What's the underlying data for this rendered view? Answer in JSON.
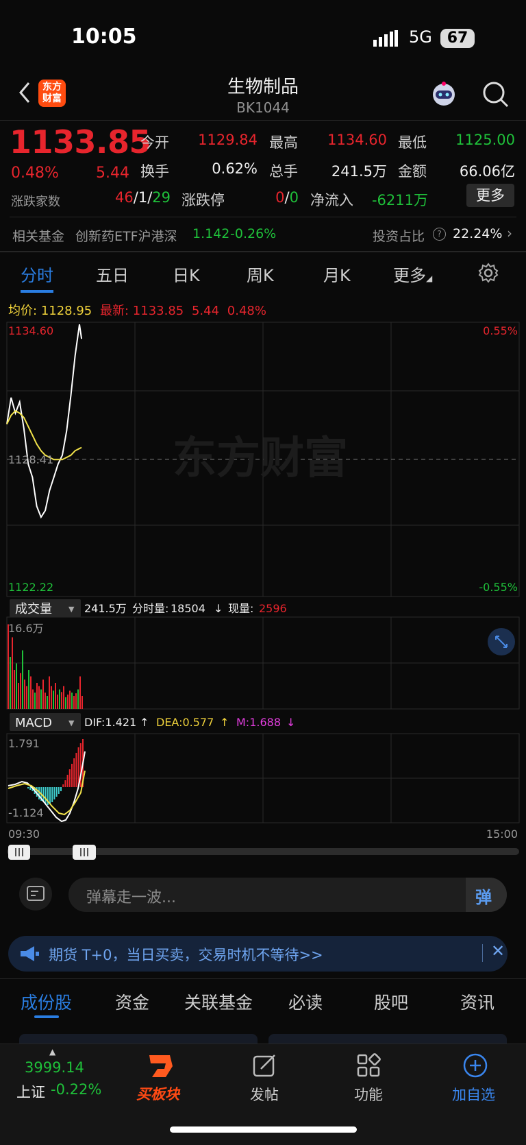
{
  "status": {
    "time": "10:05",
    "network": "5G",
    "battery": "67"
  },
  "header": {
    "title": "生物制品",
    "code": "BK1044",
    "logo_text": "东方\n财富"
  },
  "quote": {
    "price": "1133.85",
    "pct": "0.48%",
    "change": "5.44",
    "fields": [
      {
        "label": "今开",
        "value": "1129.84",
        "color": "red"
      },
      {
        "label": "最高",
        "value": "1134.60",
        "color": "red"
      },
      {
        "label": "最低",
        "value": "1125.00",
        "color": "green"
      },
      {
        "label": "换手",
        "value": "0.62%",
        "color": "white"
      },
      {
        "label": "总手",
        "value": "241.5万",
        "color": "white"
      },
      {
        "label": "金额",
        "value": "66.06亿",
        "color": "white"
      }
    ],
    "adv_label": "涨跌家数",
    "adv_up": "46",
    "adv_flat": "1",
    "adv_down": "29",
    "limit_label": "涨跌停",
    "limit_up": "0",
    "limit_down": "0",
    "netflow_label": "净流入",
    "netflow_value": "-6211万",
    "more_label": "更多"
  },
  "fund": {
    "label": "相关基金",
    "name": "创新药ETF沪港深",
    "price": "1.142",
    "chg": "-0.26%",
    "ratio_label": "投资占比",
    "ratio_value": "22.24%"
  },
  "tabs": [
    "分时",
    "五日",
    "日K",
    "周K",
    "月K",
    "更多"
  ],
  "chart": {
    "avg_label": "均价:",
    "avg_value": "1128.95",
    "last_label": "最新:",
    "last_value": "1133.85",
    "last_chg": "5.44",
    "last_pct": "0.48%",
    "y_top": "1134.60",
    "y_mid": "1128.41",
    "y_bottom": "1122.22",
    "pct_top": "0.55%",
    "pct_bottom": "-0.55%",
    "watermark": "东方财富",
    "vol_selector": "成交量",
    "vol_total": "241.5万",
    "vol_tick_label": "分时量:",
    "vol_tick": "18504",
    "vol_now_label": "现量:",
    "vol_now": "2596",
    "vol_max": "16.6万",
    "macd_selector": "MACD",
    "dif": "DIF:1.421",
    "dea": "DEA:0.577",
    "m": "M:1.688",
    "macd_top": "1.791",
    "macd_bottom": "-1.124",
    "time_start": "09:30",
    "time_end": "15:00"
  },
  "chart_data": {
    "type": "line",
    "title": "",
    "xlabel": "",
    "ylabel": "",
    "ylim": [
      1122.22,
      1134.6
    ],
    "x": [
      "09:30",
      "09:32",
      "09:34",
      "09:36",
      "09:38",
      "09:40",
      "09:42",
      "09:44",
      "09:46",
      "09:48",
      "09:50",
      "09:52",
      "09:54",
      "09:56",
      "09:58",
      "10:00",
      "10:02",
      "10:04",
      "10:05"
    ],
    "series": [
      {
        "name": "最新",
        "values": [
          1130.0,
          1131.2,
          1130.5,
          1131.0,
          1129.8,
          1128.2,
          1127.6,
          1126.3,
          1125.8,
          1126.1,
          1127.0,
          1127.6,
          1128.2,
          1128.6,
          1129.7,
          1131.3,
          1133.1,
          1134.5,
          1133.85
        ]
      },
      {
        "name": "均价",
        "values": [
          1130.0,
          1130.4,
          1130.6,
          1130.5,
          1130.3,
          1129.9,
          1129.5,
          1129.1,
          1128.8,
          1128.6,
          1128.5,
          1128.4,
          1128.4,
          1128.4,
          1128.5,
          1128.6,
          1128.8,
          1128.9,
          1128.95
        ]
      }
    ]
  },
  "danmu": {
    "placeholder": "弹幕走一波...",
    "send": "弹"
  },
  "ad": {
    "text": "期货 T+0，当日买卖，交易时机不等待>>"
  },
  "bottom_tabs": [
    "成份股",
    "资金",
    "关联基金",
    "必读",
    "股吧",
    "资讯"
  ],
  "nav": {
    "index_value": "3999.14",
    "index_name": "上证",
    "index_chg": "-0.22%",
    "items": [
      "买板块",
      "发帖",
      "功能",
      "加自选"
    ]
  },
  "colors": {
    "up": "#e7252d",
    "down": "#1fc13a",
    "accent": "#2a7de1",
    "avg": "#f1e24a"
  }
}
